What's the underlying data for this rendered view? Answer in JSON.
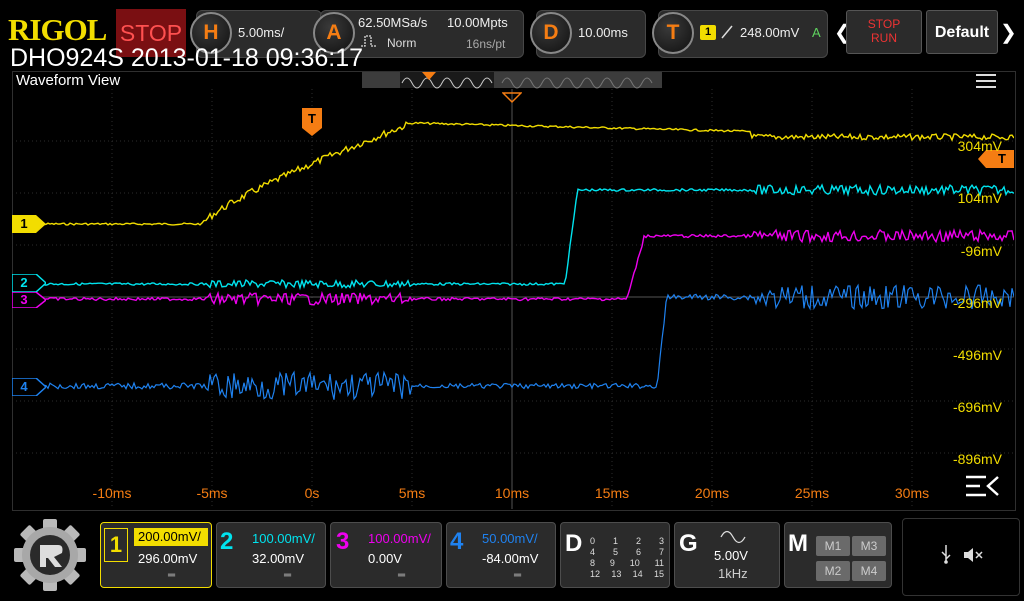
{
  "header": {
    "brand": "RIGOL",
    "status": "STOP",
    "device_info": "DHO924S 2013-01-18 09:36:17",
    "horizontal": {
      "key": "H",
      "timebase": "5.00ms/"
    },
    "acquire": {
      "key": "A",
      "sample_rate": "62.50MSa/s",
      "mode": "Norm",
      "memory_depth": "10.00Mpts",
      "sample_interval": "16ns/pt"
    },
    "delay": {
      "key": "D",
      "value": "10.00ms"
    },
    "trigger": {
      "key": "T",
      "channel": "1",
      "level": "248.00mV",
      "sweep": "A"
    },
    "run_stop": {
      "line1": "STOP",
      "line2": "RUN"
    },
    "default_label": "Default"
  },
  "waveform_view": {
    "title": "Waveform View",
    "y_labels": [
      "304mV",
      "104mV",
      "-96mV",
      "-296mV",
      "-496mV",
      "-696mV",
      "-896mV"
    ],
    "x_labels": [
      "-10ms",
      "-5ms",
      "0s",
      "5ms",
      "10ms",
      "15ms",
      "20ms",
      "25ms",
      "30ms"
    ],
    "trigger_marker": "T",
    "channel_markers": [
      "1",
      "2",
      "3",
      "4"
    ]
  },
  "channels": [
    {
      "id": "1",
      "scale": "200.00mV/",
      "offset": "296.00mV",
      "color": "#f2dd00"
    },
    {
      "id": "2",
      "scale": "100.00mV/",
      "offset": "32.00mV",
      "color": "#00e3ee"
    },
    {
      "id": "3",
      "scale": "100.00mV/",
      "offset": "0.00V",
      "color": "#ee00ee"
    },
    {
      "id": "4",
      "scale": "50.00mV/",
      "offset": "-84.00mV",
      "color": "#1f82f0"
    }
  ],
  "digital": {
    "key": "D",
    "rows": [
      [
        "0",
        "1",
        "2",
        "3"
      ],
      [
        "4",
        "5",
        "6",
        "7"
      ],
      [
        "8",
        "9",
        "10",
        "11"
      ],
      [
        "12",
        "13",
        "14",
        "15"
      ]
    ]
  },
  "generator": {
    "key": "G",
    "amplitude": "5.00V",
    "frequency": "1kHz"
  },
  "math": {
    "key": "M",
    "buttons": [
      "M1",
      "M3",
      "M2",
      "M4"
    ]
  },
  "colors": {
    "accent": "#f57d13",
    "stop": "#7a0f12"
  }
}
